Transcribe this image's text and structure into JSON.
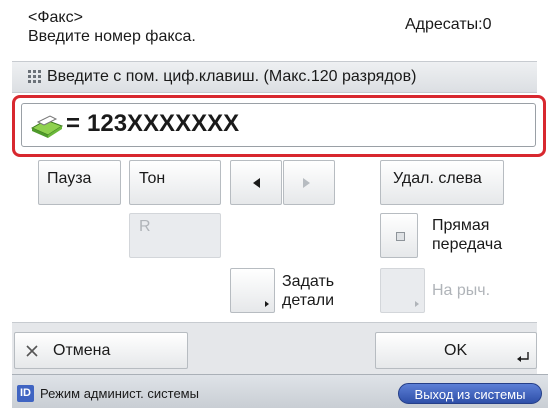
{
  "header": {
    "mode": "<Факс>",
    "instruction": "Введите номер факса.",
    "destinations": "Адресаты:0"
  },
  "hint": {
    "icon": "keypad-icon",
    "text": "Введите с пом. циф.клавиш. (Макс.120 разрядов)"
  },
  "number_field": {
    "icon": "fax-icon",
    "prefix": "=",
    "value": "123XXXXXXX"
  },
  "buttons": {
    "pause": "Пауза",
    "tone": "Тон",
    "r": "R",
    "delete_left": "Удал. слева",
    "direct_send_line1": "Прямая",
    "direct_send_line2": "передача",
    "details_line1": "Задать",
    "details_line2": "детали",
    "on_hook": "На рыч.",
    "cancel": "Отмена",
    "ok": "OK"
  },
  "status": {
    "badge": "ID",
    "admin_mode": "Режим админист. системы",
    "logout": "Выход из системы"
  },
  "colors": {
    "accent_red": "#d8282f",
    "status_blue": "#3f64c2"
  }
}
